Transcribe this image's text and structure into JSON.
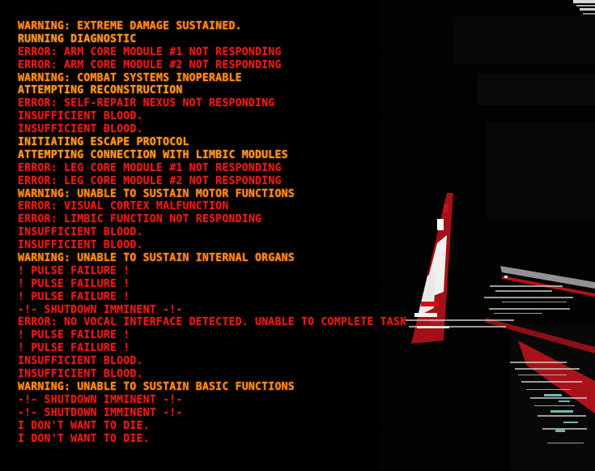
{
  "colors": {
    "warning": "#ff8c1a",
    "error": "#e8201c",
    "background": "#000000",
    "glitch_white": "#e6e6e6",
    "glitch_red": "#c4141c",
    "glitch_cyan": "#7fd6d0"
  },
  "log": [
    {
      "type": "warning",
      "text": "WARNING: EXTREME DAMAGE SUSTAINED."
    },
    {
      "type": "status",
      "text": "RUNNING DIAGNOSTIC"
    },
    {
      "type": "error",
      "text": "ERROR: ARM CORE MODULE #1 NOT RESPONDING"
    },
    {
      "type": "error",
      "text": "ERROR: ARM CORE MODULE #2 NOT RESPONDING"
    },
    {
      "type": "warning",
      "text": "WARNING: COMBAT SYSTEMS INOPERABLE"
    },
    {
      "type": "status",
      "text": "ATTEMPTING RECONSTRUCTION"
    },
    {
      "type": "error",
      "text": "ERROR: SELF-REPAIR NEXUS NOT RESPONDING"
    },
    {
      "type": "error",
      "text": "INSUFFICIENT BLOOD."
    },
    {
      "type": "error",
      "text": "INSUFFICIENT BLOOD."
    },
    {
      "type": "status",
      "text": "INITIATING ESCAPE PROTOCOL"
    },
    {
      "type": "status",
      "text": "ATTEMPTING CONNECTION WITH LIMBIC MODULES"
    },
    {
      "type": "error",
      "text": "ERROR: LEG CORE MODULE #1 NOT RESPONDING"
    },
    {
      "type": "error",
      "text": "ERROR: LEG CORE MODULE #2 NOT RESPONDING"
    },
    {
      "type": "warning",
      "text": "WARNING: UNABLE TO SUSTAIN MOTOR FUNCTIONS"
    },
    {
      "type": "error",
      "text": "ERROR: VISUAL CORTEX MALFUNCTION"
    },
    {
      "type": "error",
      "text": "ERROR: LIMBIC FUNCTION NOT RESPONDING"
    },
    {
      "type": "error",
      "text": "INSUFFICIENT BLOOD."
    },
    {
      "type": "error",
      "text": "INSUFFICIENT BLOOD."
    },
    {
      "type": "warning",
      "text": "WARNING: UNABLE TO SUSTAIN INTERNAL ORGANS"
    },
    {
      "type": "error",
      "text": "! PULSE FAILURE !"
    },
    {
      "type": "error",
      "text": "! PULSE FAILURE !"
    },
    {
      "type": "error",
      "text": "! PULSE FAILURE !"
    },
    {
      "type": "error",
      "text": "-!- SHUTDOWN IMMINENT -!-"
    },
    {
      "type": "error",
      "text": "ERROR: NO VOCAL INTERFACE DETECTED. UNABLE TO COMPLETE TASK"
    },
    {
      "type": "error",
      "text": "! PULSE FAILURE !"
    },
    {
      "type": "error",
      "text": "! PULSE FAILURE !"
    },
    {
      "type": "error",
      "text": "INSUFFICIENT BLOOD."
    },
    {
      "type": "error",
      "text": "INSUFFICIENT BLOOD."
    },
    {
      "type": "warning",
      "text": "WARNING: UNABLE TO SUSTAIN BASIC FUNCTIONS"
    },
    {
      "type": "error",
      "text": "-!- SHUTDOWN IMMINENT -!-"
    },
    {
      "type": "error",
      "text": "-!- SHUTDOWN IMMINENT -!-"
    },
    {
      "type": "error",
      "text": "I DON'T WANT TO DIE."
    },
    {
      "type": "error",
      "text": "I DON'T WANT TO DIE."
    }
  ]
}
